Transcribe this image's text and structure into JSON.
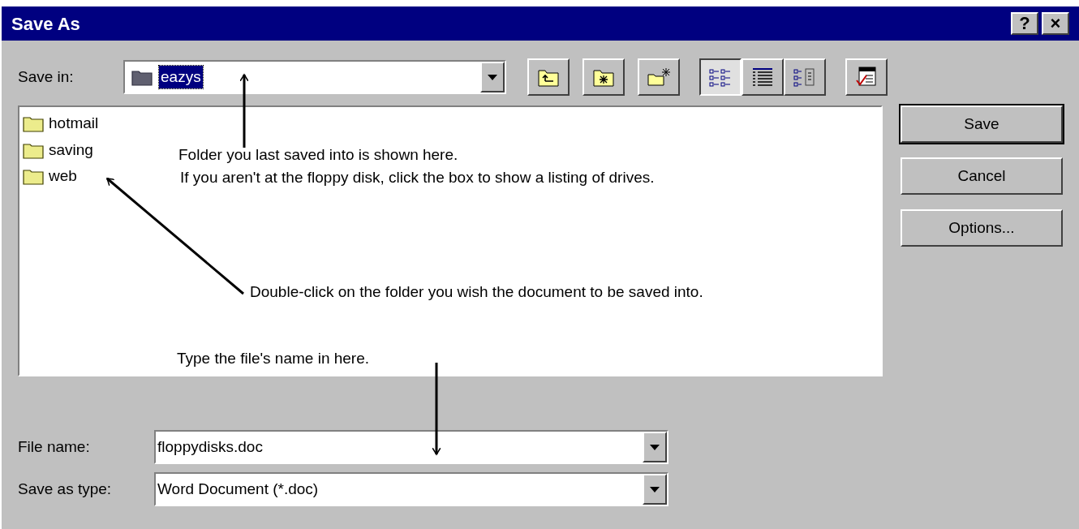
{
  "window": {
    "title": "Save As",
    "title_buttons": [
      "?",
      "×"
    ]
  },
  "save_in": {
    "label": "Save in:",
    "value": "eazys",
    "value_selected": true
  },
  "toolbar": [
    {
      "kind": "up-folder",
      "pressed": false
    },
    {
      "kind": "desktop",
      "pressed": false
    },
    {
      "kind": "new-folder",
      "pressed": false
    },
    {
      "kind": "list-view",
      "pressed": true
    },
    {
      "kind": "details-view",
      "pressed": false
    },
    {
      "kind": "properties-view",
      "pressed": false
    },
    {
      "kind": "commands",
      "pressed": false
    }
  ],
  "files": [
    {
      "name": "hotmail"
    },
    {
      "name": "saving"
    },
    {
      "name": "web"
    }
  ],
  "annotations": [
    "Folder you last saved into is shown here.",
    "If you aren't at the floppy disk, click the box to show a listing of drives.",
    "Double-click on the folder you wish the document to be saved into.",
    "Type the file's name in here."
  ],
  "buttons": [
    {
      "label": "Save",
      "default": true
    },
    {
      "label": "Cancel",
      "default": false
    },
    {
      "label": "Options...",
      "default": false
    }
  ],
  "file_name": {
    "label": "File name:",
    "value": "floppydisks.doc"
  },
  "save_as_type": {
    "label": "Save as type:",
    "value": "Word Document (*.doc)"
  }
}
